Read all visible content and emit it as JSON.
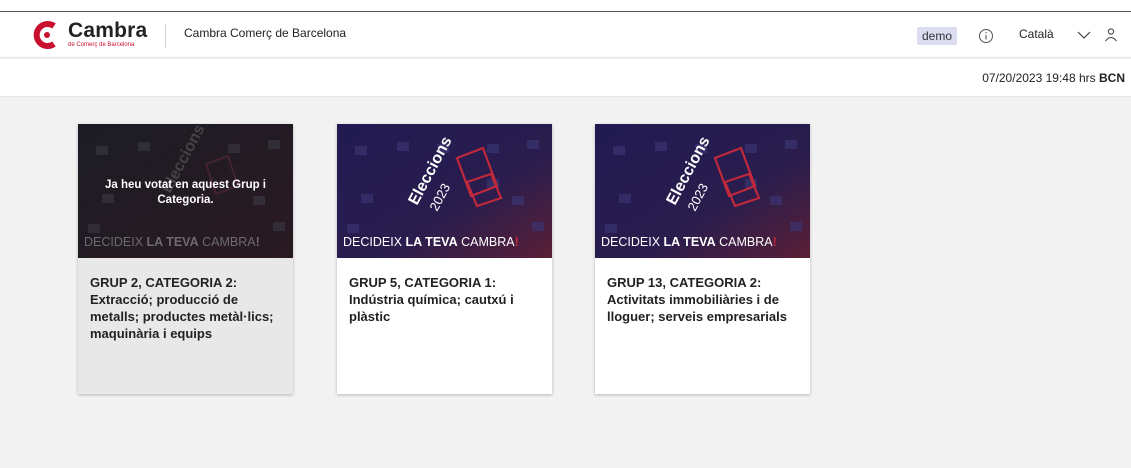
{
  "header": {
    "logo_word": "Cambra",
    "logo_sub": "de Comerç de Barcelona",
    "org_name": "Cambra Comerç de Barcelona",
    "user_badge": "demo",
    "language": "Català",
    "icons": [
      "info-icon",
      "chevron-down-icon",
      "user-icon"
    ]
  },
  "subbar": {
    "date": "07/20/2023",
    "time": "19:48 hrs",
    "zone": "BCN"
  },
  "banner": {
    "slogan_pre": "DECIDEIX ",
    "slogan_bold": "LA TEVA",
    "slogan_post": " CAMBRA",
    "slogan_bang": "!",
    "elections_word": "Eleccions",
    "elections_year": "2023"
  },
  "cards": [
    {
      "title": "GRUP 2, CATEGORIA 2:",
      "description": "Extracció; producció de metalls; productes metàl·lics; maquinària i equips",
      "voted": true,
      "voted_message": "Ja heu votat en aquest Grup i Categoria."
    },
    {
      "title": "GRUP 5, CATEGORIA 1:",
      "description": "Indústria química; cautxú i plàstic",
      "voted": false
    },
    {
      "title": "GRUP 13, CATEGORIA 2:",
      "description": "Activitats immobiliàries i de lloguer; serveis empresarials",
      "voted": false
    }
  ],
  "colors": {
    "brand_red": "#c8102e",
    "banner_dark": "#1e1a4a",
    "banner_accent": "#c0283c",
    "badge_bg": "#dcdcf2"
  }
}
